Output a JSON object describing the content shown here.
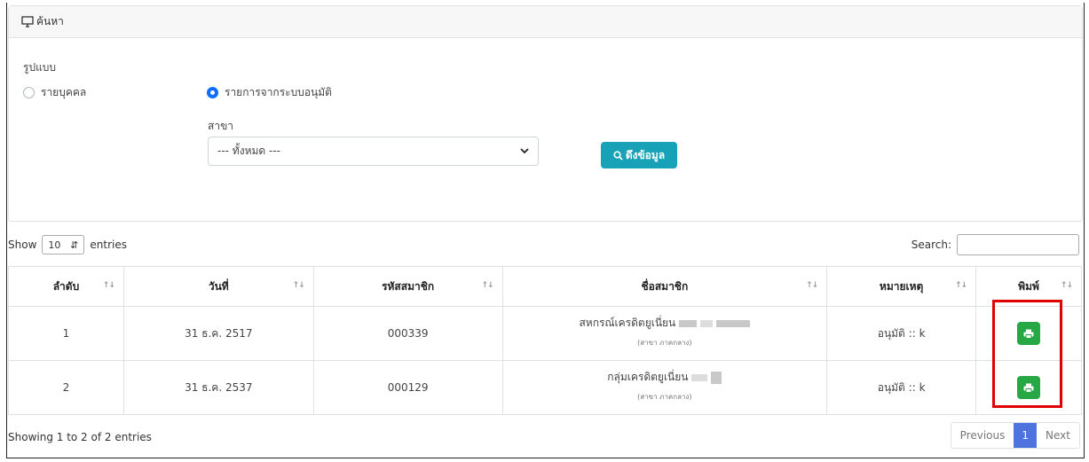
{
  "search_card": {
    "title": "ค้นหา",
    "format_label": "รูปแบบ",
    "option_person": "รายบุคคล",
    "option_approved": "รายการจากระบบอนุมัติ",
    "branch_label": "สาขา",
    "branch_selected": "--- ทั้งหมด ---",
    "fetch_label": "ดึงข้อมูล"
  },
  "controls": {
    "show_label": "Show",
    "entries_value": "10",
    "entries_label": "entries",
    "search_label": "Search:"
  },
  "table": {
    "headers": [
      "ลำดับ",
      "วันที่",
      "รหัสสมาชิก",
      "ชื่อสมาชิก",
      "หมายเหตุ",
      "พิมพ์"
    ],
    "rows": [
      {
        "no": "1",
        "date": "31 ธ.ค. 2517",
        "member_id": "000339",
        "name": "สหกรณ์เครดิตยูเนี่ยน",
        "branch": "(สาขา ภาคกลาง)",
        "note": "อนุมัติ :: k"
      },
      {
        "no": "2",
        "date": "31 ธ.ค. 2537",
        "member_id": "000129",
        "name": "กลุ่มเครดิตยูเนี่ยน",
        "branch": "(สาขา ภาคกลาง)",
        "note": "อนุมัติ :: k"
      }
    ]
  },
  "footer": {
    "info": "Showing 1 to 2 of 2 entries",
    "previous": "Previous",
    "current_page": "1",
    "next": "Next"
  },
  "colors": {
    "fetch_button": "#17a2b8",
    "print_button": "#28a745",
    "highlight": "#e00000",
    "radio_active": "#0d6efd",
    "page_active": "#4e73df"
  },
  "icons": [
    "monitor-icon",
    "search-icon",
    "printer-icon",
    "sort-icon",
    "chevron-down-icon"
  ]
}
